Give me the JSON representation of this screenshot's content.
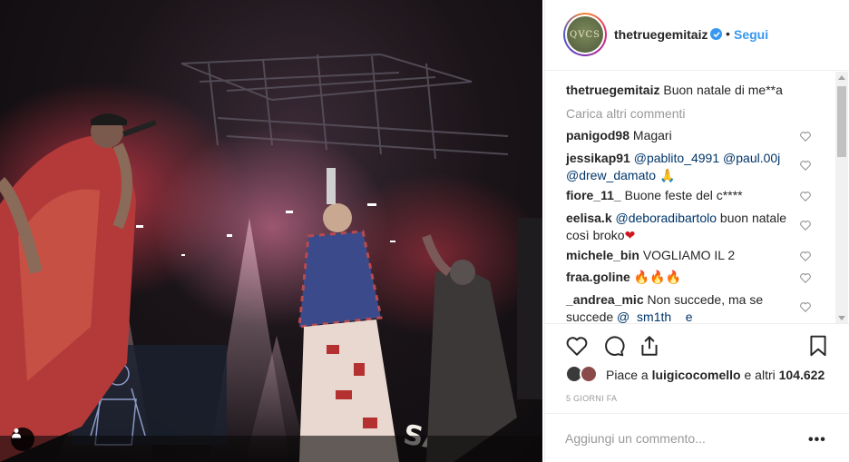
{
  "post": {
    "username": "thetruegemitaiz",
    "follow_label": "Segui",
    "dot": "•",
    "avatar_text": "QVCS",
    "caption": {
      "user": "thetruegemitaiz",
      "text": "Buon natale di me**a"
    },
    "load_more_label": "Carica altri commenti",
    "comments": [
      {
        "user": "panigod98",
        "text": "Magari"
      },
      {
        "user": "jessikap91",
        "mentions": [
          "@pablito_4991",
          "@paul.00j",
          "@drew_damato"
        ],
        "emoji": "🙏"
      },
      {
        "user": "fiore_11_",
        "text": "Buone feste del c****"
      },
      {
        "user": "eelisa.k",
        "mention": "@deboradibartolo",
        "text": "buon natale così broko",
        "emoji": "❤"
      },
      {
        "user": "michele_bin",
        "text": "VOGLIAMO IL 2"
      },
      {
        "user": "fraa.goline",
        "text": "🔥🔥🔥"
      },
      {
        "user": "_andrea_mic",
        "text": "Non succede, ma se succede",
        "mention": "@_sm1th__e"
      }
    ],
    "likes": {
      "prefix": "Piace a ",
      "user": "luigicocomello",
      "middle": " e altri ",
      "count": "104.622"
    },
    "timestamp": "5 GIORNI FA",
    "comment_placeholder": "Aggiungi un commento...",
    "more_options": "•••"
  },
  "icons": {
    "verified": "verified-badge-icon",
    "heart": "heart-outline-icon",
    "comment": "comment-bubble-icon",
    "share": "share-upload-icon",
    "bookmark": "bookmark-icon",
    "user_tag": "user-silhouette-icon"
  },
  "colors": {
    "link": "#3897f0",
    "mention": "#003569",
    "muted": "#999999",
    "text": "#262626"
  }
}
